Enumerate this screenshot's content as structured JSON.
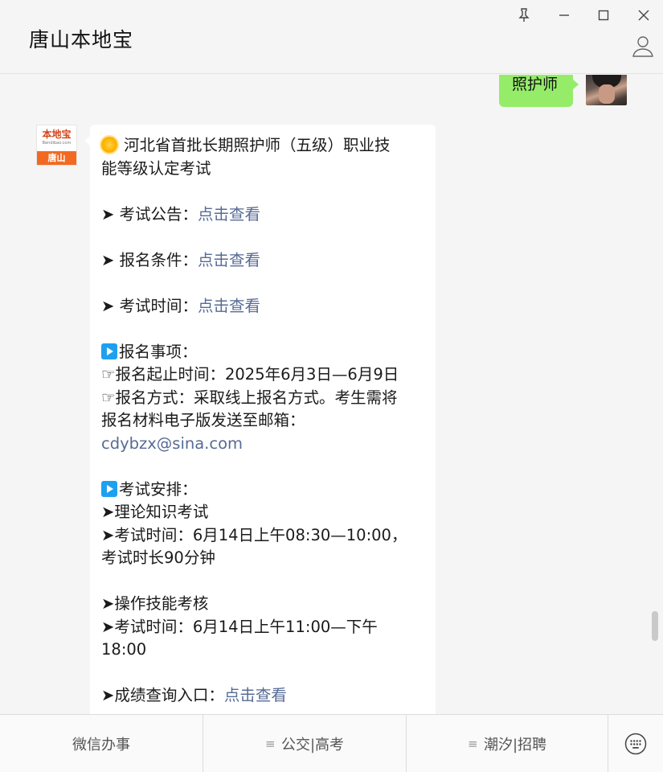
{
  "window": {
    "title": "唐山本地宝",
    "controls": [
      "pin-icon",
      "minimize-icon",
      "maximize-icon",
      "close-icon"
    ],
    "profile_icon": "user-icon"
  },
  "chat": {
    "outgoing": {
      "text": "照护师",
      "bubble_color": "#95ec69"
    },
    "incoming": {
      "avatar_text_top": "本地宝",
      "avatar_text_sub": "Bendibao.com",
      "avatar_text_bottom": "唐山",
      "accent_color": "#f26a21",
      "title_line1": "河北省首批长期照护师（五级）职业技",
      "title_line2": "能等级认定考试",
      "items": [
        {
          "prefix": "➤ 考试公告：",
          "link": "点击查看"
        },
        {
          "prefix": "➤ 报名条件：",
          "link": "点击查看"
        },
        {
          "prefix": "➤ 考试时间：",
          "link": "点击查看"
        }
      ],
      "registration": {
        "heading": "报名事项：",
        "time_line": "☞报名起止时间：2025年6月3日—6月9日",
        "method_line1": "☞报名方式：采取线上报名方式。考生需将",
        "method_line2": "报名材料电子版发送至邮箱：",
        "email": "cdybzx@sina.com"
      },
      "exam": {
        "heading": "考试安排：",
        "theory_title": "➤理论知识考试",
        "theory_time_line1": "➤考试时间：6月14日上午08:30—10:00，",
        "theory_time_line2": "考试时长90分钟",
        "practical_title": "➤操作技能考核",
        "practical_time_line1": "➤考试时间：6月14日上午11:00—下午",
        "practical_time_line2": "18:00"
      },
      "score": {
        "prefix": "➤成绩查询入口：",
        "link": "点击查看"
      },
      "link_color": "#576b95"
    }
  },
  "bottom_menu": {
    "items": [
      {
        "label": "微信办事",
        "has_submenu": false
      },
      {
        "label": "公交|高考",
        "has_submenu": true
      },
      {
        "label": "潮汐|招聘",
        "has_submenu": true
      }
    ],
    "submenu_icon": "menu-lines-icon",
    "keyboard_icon": "keyboard-icon"
  }
}
